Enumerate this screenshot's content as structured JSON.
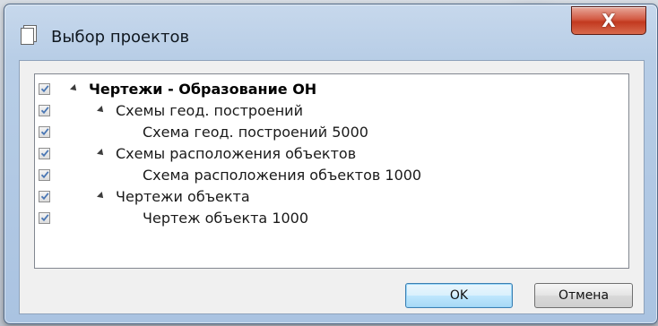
{
  "window": {
    "title": "Выбор проектов",
    "close_glyph": "X"
  },
  "tree": {
    "items": [
      {
        "label": "Чертежи - Образование ОН",
        "checked": true,
        "level": 0,
        "expanded": true,
        "bold": true
      },
      {
        "label": "Схемы геод. построений",
        "checked": true,
        "level": 1,
        "expanded": true
      },
      {
        "label": "Схема геод. построений 5000",
        "checked": true,
        "level": 2
      },
      {
        "label": "Схемы расположения объектов",
        "checked": true,
        "level": 1,
        "expanded": true
      },
      {
        "label": "Схема расположения объектов 1000",
        "checked": true,
        "level": 2
      },
      {
        "label": "Чертежи объекта",
        "checked": true,
        "level": 1,
        "expanded": true
      },
      {
        "label": "Чертеж объекта 1000",
        "checked": true,
        "level": 2
      }
    ]
  },
  "buttons": {
    "ok_label": "OK",
    "cancel_label": "Отмена"
  },
  "colors": {
    "check": "#4a77b4",
    "close_button": "#c2391f"
  }
}
